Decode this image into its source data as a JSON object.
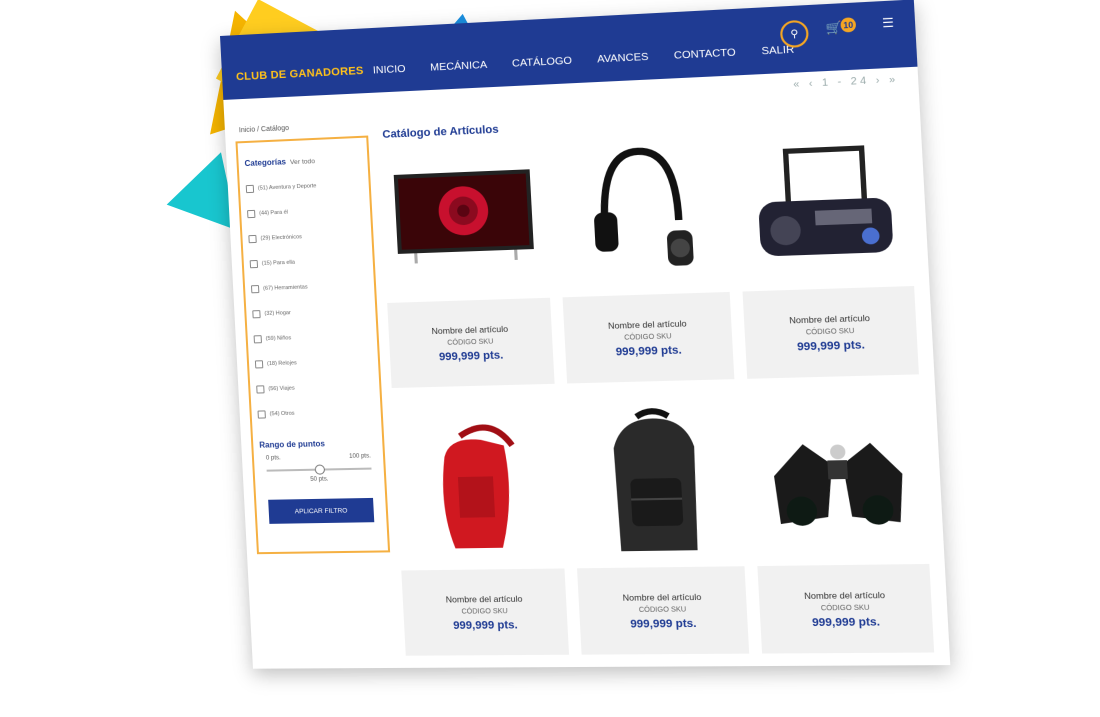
{
  "brand": "CLUB DE GANADORES",
  "nav": [
    "INICIO",
    "MECÁNICA",
    "CATÁLOGO",
    "AVANCES",
    "CONTACTO",
    "SALIR"
  ],
  "cart_count": "10",
  "breadcrumb": "Inicio / Catálogo",
  "pager": "« ‹ 1 - 24 › »",
  "filters": {
    "categories_label": "Categorías",
    "view_all": "Ver todo",
    "categories": [
      "(51) Aventura y Deporte",
      "(44) Para él",
      "(29) Electrónicos",
      "(15) Para ella",
      "(67) Herramientas",
      "(32) Hogar",
      "(59) Niños",
      "(18) Relojes",
      "(56) Viajes",
      "(54) Otros"
    ],
    "range_label": "Rango de puntos",
    "range_min": "0 pts.",
    "range_max": "100 pts.",
    "range_value": "50 pts.",
    "range_fraction": 0.5,
    "apply": "APLICAR FILTRO"
  },
  "catalog_title": "Catálogo de Artículos",
  "products": [
    {
      "name": "Nombre del artículo",
      "sku": "CÓDIGO SKU",
      "price": "999,999 pts.",
      "icon": "tv-icon"
    },
    {
      "name": "Nombre del artículo",
      "sku": "CÓDIGO SKU",
      "price": "999,999 pts.",
      "icon": "headphones-icon"
    },
    {
      "name": "Nombre del artículo",
      "sku": "CÓDIGO SKU",
      "price": "999,999 pts.",
      "icon": "radio-icon"
    },
    {
      "name": "Nombre del artículo",
      "sku": "CÓDIGO SKU",
      "price": "999,999 pts.",
      "icon": "sling-bag-icon"
    },
    {
      "name": "Nombre del artículo",
      "sku": "CÓDIGO SKU",
      "price": "999,999 pts.",
      "icon": "backpack-icon"
    },
    {
      "name": "Nombre del artículo",
      "sku": "CÓDIGO SKU",
      "price": "999,999 pts.",
      "icon": "binoculars-icon"
    }
  ],
  "colors": {
    "navy": "#1f3b93",
    "accent": "#f5a623"
  }
}
